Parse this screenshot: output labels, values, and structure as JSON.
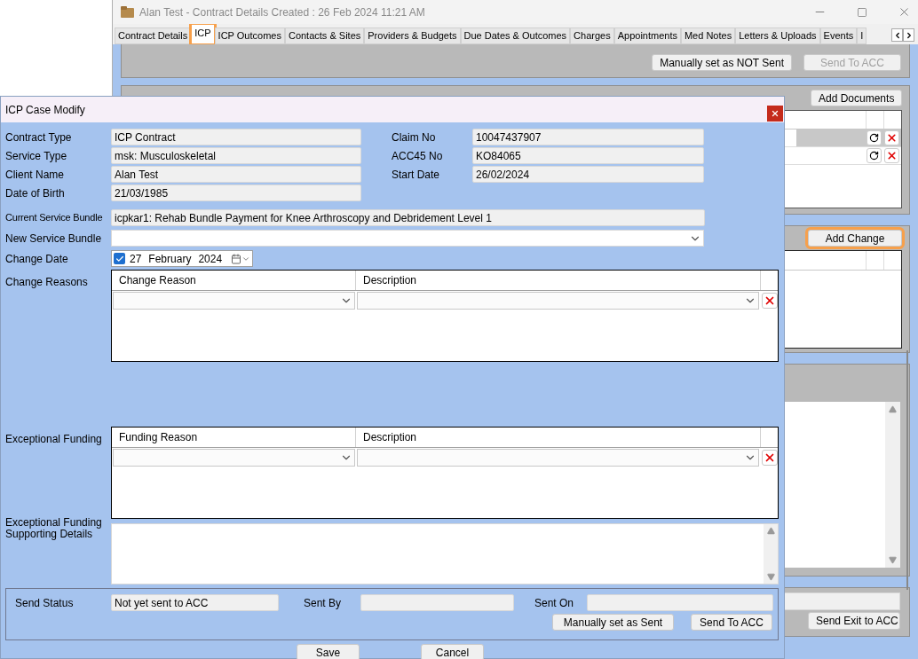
{
  "main_window": {
    "title": "Alan Test - Contract Details Created : 26 Feb 2024 11:21 AM",
    "tabs": [
      {
        "label": "Contract Details",
        "selected": false,
        "highlighted": false
      },
      {
        "label": "ICP",
        "selected": true,
        "highlighted": true
      },
      {
        "label": "ICP Outcomes",
        "selected": false,
        "highlighted": false
      },
      {
        "label": "Contacts & Sites",
        "selected": false,
        "highlighted": false
      },
      {
        "label": "Providers & Budgets",
        "selected": false,
        "highlighted": false
      },
      {
        "label": "Due Dates & Outcomes",
        "selected": false,
        "highlighted": false
      },
      {
        "label": "Charges",
        "selected": false,
        "highlighted": false
      },
      {
        "label": "Appointments",
        "selected": false,
        "highlighted": false
      },
      {
        "label": "Med Notes",
        "selected": false,
        "highlighted": false
      },
      {
        "label": "Letters & Uploads",
        "selected": false,
        "highlighted": false
      },
      {
        "label": "Events",
        "selected": false,
        "highlighted": false
      },
      {
        "label": "I",
        "selected": false,
        "highlighted": false
      }
    ],
    "top_panel": {
      "buttons": [
        {
          "label": "Manually set as NOT Sent",
          "disabled": false
        },
        {
          "label": "Send To ACC",
          "disabled": true
        }
      ]
    },
    "documents_panel": {
      "button": "Add Documents",
      "rows": [
        {
          "selected": true
        },
        {
          "selected": false
        }
      ]
    },
    "changes_panel": {
      "button": "Add Change",
      "highlighted": true
    },
    "exit_panel": {
      "button": "Send Exit to ACC"
    }
  },
  "dialog": {
    "title": "ICP Case Modify",
    "left_fields": [
      {
        "label": "Contract Type",
        "value": "ICP Contract"
      },
      {
        "label": "Service Type",
        "value": "msk: Musculoskeletal"
      },
      {
        "label": "Client Name",
        "value": "Alan Test"
      },
      {
        "label": "Date of Birth",
        "value": "21/03/1985"
      }
    ],
    "right_fields": [
      {
        "label": "Claim No",
        "value": "10047437907"
      },
      {
        "label": "ACC45 No",
        "value": "KO84065"
      },
      {
        "label": "Start Date",
        "value": "26/02/2024"
      }
    ],
    "current_service_bundle": {
      "label": "Current Service Bundle",
      "value": "icpkar1: Rehab Bundle Payment for Knee Arthroscopy and Debridement Level 1"
    },
    "new_service_bundle": {
      "label": "New Service Bundle"
    },
    "change_date": {
      "label": "Change Date",
      "checked": true,
      "day": "27",
      "month": "February",
      "year": "2024"
    },
    "change_reasons": {
      "label": "Change Reasons",
      "columns": [
        "Change Reason",
        "Description"
      ]
    },
    "exceptional_funding": {
      "label": "Exceptional Funding",
      "columns": [
        "Funding Reason",
        "Description"
      ]
    },
    "supporting_details": {
      "label": "Exceptional Funding Supporting Details"
    },
    "send": {
      "status_label": "Send Status",
      "status_value": "Not yet sent to ACC",
      "sent_by_label": "Sent By",
      "sent_on_label": "Sent On",
      "buttons": [
        "Manually set as Sent",
        "Send To ACC"
      ]
    },
    "buttons": [
      "Save",
      "Cancel"
    ]
  }
}
